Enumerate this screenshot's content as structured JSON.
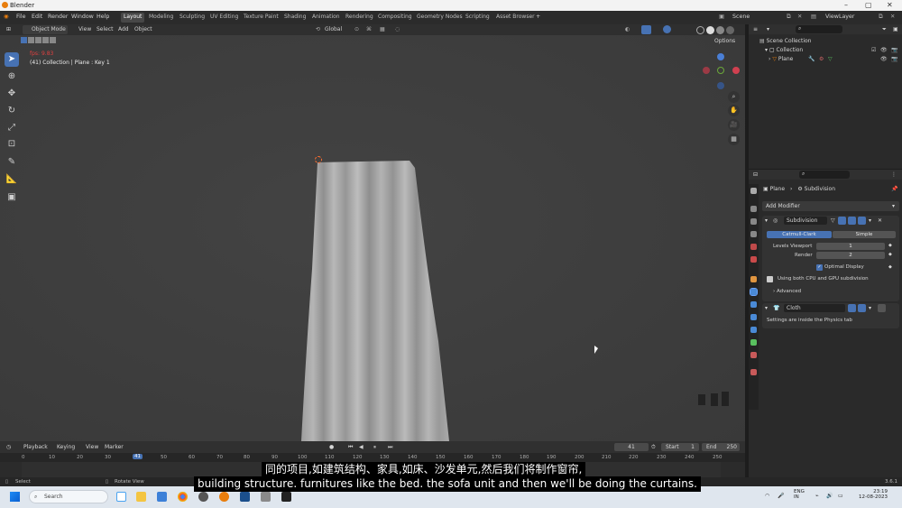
{
  "window": {
    "title": "Blender"
  },
  "menus": [
    "File",
    "Edit",
    "Render",
    "Window",
    "Help"
  ],
  "workspaces": [
    "Layout",
    "Modeling",
    "Sculpting",
    "UV Editing",
    "Texture Paint",
    "Shading",
    "Animation",
    "Rendering",
    "Compositing",
    "Geometry Nodes",
    "Scripting",
    "Asset Browser"
  ],
  "active_workspace": "Layout",
  "scene": {
    "name": "Scene",
    "view_layer": "ViewLayer"
  },
  "viewport_header": {
    "mode": "Object Mode",
    "view": "View",
    "select": "Select",
    "add": "Add",
    "object": "Object",
    "orientation": "Global",
    "options": "Options"
  },
  "viewport": {
    "fps": "fps: 9.83",
    "info": "(41) Collection | Plane : Key 1"
  },
  "outliner": {
    "scene_collection": "Scene Collection",
    "collection": "Collection",
    "object": "Plane"
  },
  "properties": {
    "breadcrumb_object": "Plane",
    "breadcrumb_modifier": "Subdivision",
    "add_modifier": "Add Modifier",
    "subdivision": {
      "name": "Subdivision",
      "type_catmull": "Catmull-Clark",
      "type_simple": "Simple",
      "levels_viewport_label": "Levels Viewport",
      "levels_viewport": "1",
      "render_label": "Render",
      "render": "2",
      "optimal_display": "Optimal Display",
      "gpu_note": "Using both CPU and GPU subdivision",
      "advanced": "Advanced"
    },
    "cloth": {
      "name": "Cloth",
      "note": "Settings are inside the Physics tab"
    }
  },
  "timeline": {
    "playback": "Playback",
    "keying": "Keying",
    "view": "View",
    "marker": "Marker",
    "current_frame": "41",
    "start_label": "Start",
    "start": "1",
    "end_label": "End",
    "end": "250",
    "ruler": [
      "0",
      "10",
      "20",
      "30",
      "41",
      "50",
      "60",
      "70",
      "80",
      "90",
      "100",
      "110",
      "120",
      "130",
      "140",
      "150",
      "160",
      "170",
      "180",
      "190",
      "200",
      "210",
      "220",
      "230",
      "240",
      "250"
    ]
  },
  "statusbar": {
    "select": "Select",
    "rotate": "Rotate View",
    "version": "3.6.1"
  },
  "taskbar": {
    "search": "Search",
    "lang1": "ENG",
    "lang2": "IN",
    "time": "23:19",
    "date": "12-08-2023"
  },
  "subtitles": {
    "zh": "同的项目,如建筑结构、家具,如床、沙发单元,然后我们将制作窗帘,",
    "en": "building structure. furnitures like the bed. the sofa unit and then we'll be doing the curtains."
  },
  "colors": {
    "accent": "#4772b3",
    "curtain": "#a8a8a8",
    "orange": "#e87d0d"
  }
}
